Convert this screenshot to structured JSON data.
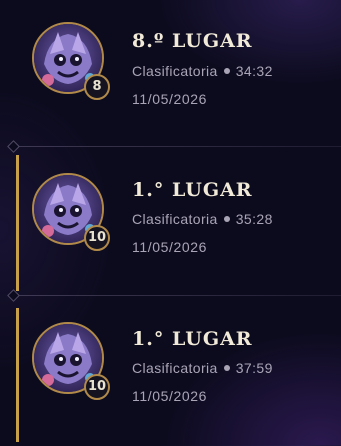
{
  "matches": [
    {
      "placement": "8.º LUGAR",
      "queue": "Clasificatoria",
      "duration": "34:32",
      "date": "11/05/2026",
      "level": "8",
      "top_finish": false
    },
    {
      "placement": "1.° LUGAR",
      "queue": "Clasificatoria",
      "duration": "35:28",
      "date": "11/05/2026",
      "level": "10",
      "top_finish": true
    },
    {
      "placement": "1.° LUGAR",
      "queue": "Clasificatoria",
      "duration": "37:59",
      "date": "11/05/2026",
      "level": "10",
      "top_finish": true
    }
  ],
  "colors": {
    "accent_gold": "#c8a04a",
    "text_primary": "#f1ead8",
    "text_secondary": "#aaa5b6",
    "background": "#0c0b1e"
  },
  "icons": {
    "avatar": "little-legend-avatar-icon"
  }
}
